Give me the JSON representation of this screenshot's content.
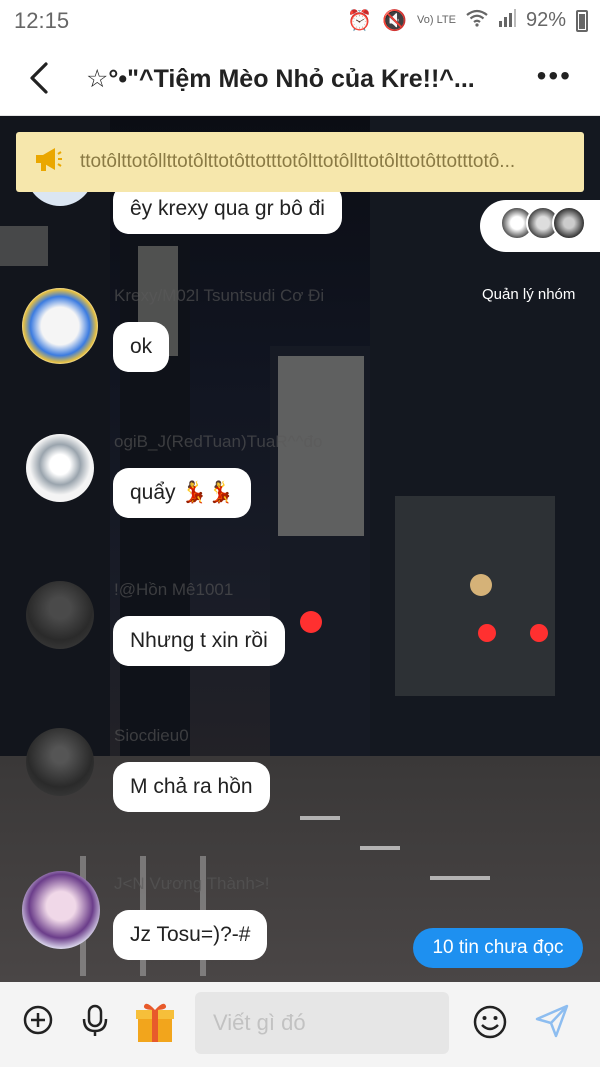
{
  "status_bar": {
    "time": "12:15",
    "network": "Vo) LTE",
    "battery": "92%"
  },
  "header": {
    "title": "☆°•\"^Tiệm Mèo Nhỏ của Kre!!^..."
  },
  "announcement": {
    "text": "ttotôlttotôllttotôlttotôttotttotôlttotôllttotôlttotôttotttotô..."
  },
  "group": {
    "admin_label": "Quản lý nhóm"
  },
  "messages": [
    {
      "text": "êy krexy qua gr bô đi"
    },
    {
      "text": "ok",
      "sender": "Krexy/M02l Tsuntsudi Cơ Đi"
    },
    {
      "text": "quẩy 💃💃",
      "sender": "ogiB_J(RedTuan)TuaR^^đo"
    },
    {
      "text": "Nhưng t xin rồi",
      "sender": "!@Hồn Mê1001"
    },
    {
      "text": "M chả ra hồn",
      "sender": "Siocdieu0"
    },
    {
      "text": "Jz Tosu=)?-#",
      "sender": "J<N Vương Thành>!"
    }
  ],
  "unread_button": "10 tin chưa đọc",
  "input": {
    "placeholder": "Viết gì đó"
  },
  "colors": {
    "accent": "#1e90f0",
    "announcement_bg": "#f6e7ac",
    "bubble": "#ffffff"
  },
  "icons": [
    "back-icon",
    "more-icon",
    "megaphone-icon",
    "add-icon",
    "mic-icon",
    "gift-icon",
    "emoji-icon",
    "send-icon"
  ]
}
